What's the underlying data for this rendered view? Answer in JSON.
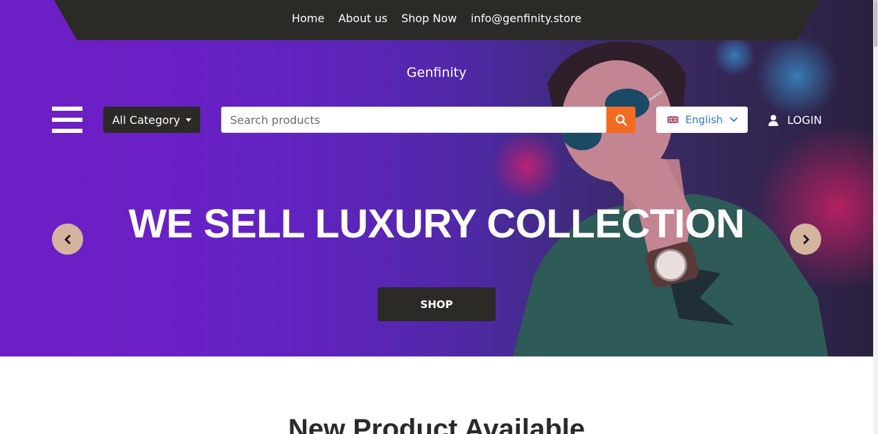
{
  "nav": {
    "links": [
      "Home",
      "About us",
      "Shop Now",
      "info@genfinity.store"
    ]
  },
  "brand": "Genfinity",
  "header": {
    "category_label": "All Category",
    "search_placeholder": "Search products",
    "language": "English",
    "login_label": "LOGIN"
  },
  "hero": {
    "headline": "WE SELL LUXURY COLLECTION",
    "button_label": "SHOP"
  },
  "section": {
    "title": "New Product Available"
  },
  "colors": {
    "accent": "#f26b21",
    "dark": "#2b2a27",
    "purple": "#6d1fc5",
    "arrow_bg": "#d4b49e",
    "language_text": "#2a7bd4"
  },
  "icons": {
    "menu": "hamburger-icon",
    "dropdown": "caret-down-icon",
    "search": "search-icon",
    "flag": "uk-flag-icon",
    "chevron": "chevron-down-icon",
    "user": "user-icon",
    "prev": "chevron-left-icon",
    "next": "chevron-right-icon"
  }
}
